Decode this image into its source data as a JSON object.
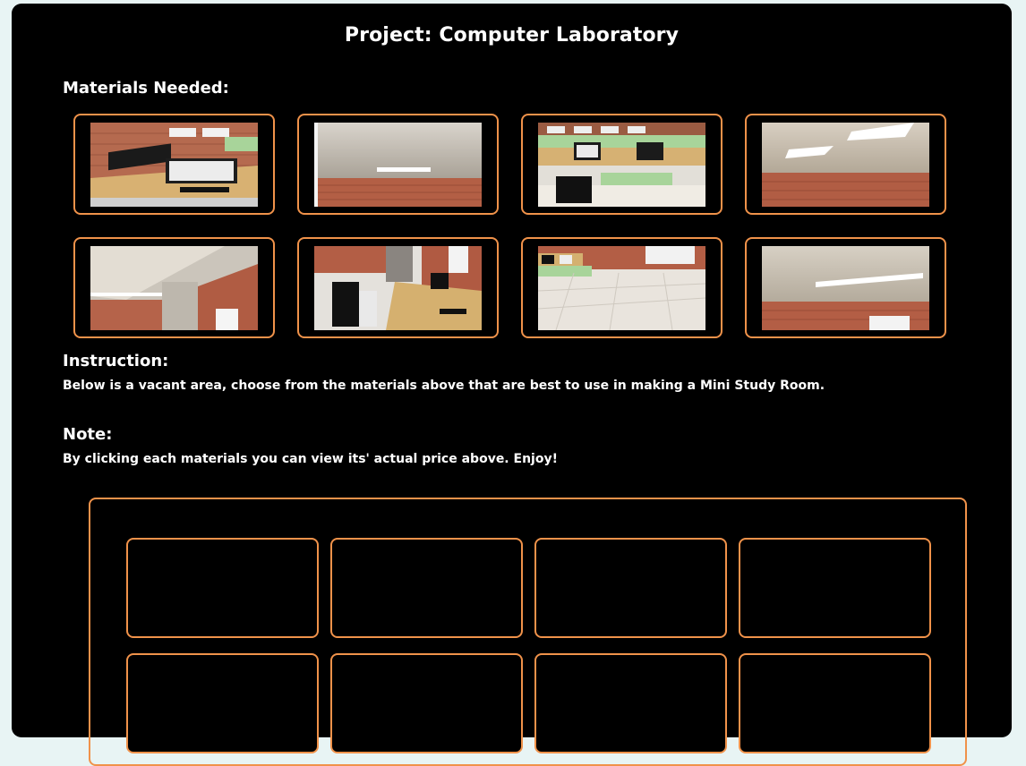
{
  "page": {
    "title": "Project: Computer Laboratory",
    "materials_heading": "Materials Needed:",
    "instruction_heading": "Instruction:",
    "instruction_text": "Below is a vacant area, choose from the materials above that are best to use in making a Mini Study Room.",
    "note_heading": "Note:",
    "note_text": "By clicking each materials you can view its' actual price above. Enjoy!"
  },
  "colors": {
    "accent": "#f0924a",
    "background": "#000000",
    "page_background": "#e8f4f4"
  },
  "materials": [
    {
      "icon": "computer-desks-image"
    },
    {
      "icon": "ceiling-light-image"
    },
    {
      "icon": "computer-room-image"
    },
    {
      "icon": "ceiling-lights-image"
    },
    {
      "icon": "ceiling-wall-image"
    },
    {
      "icon": "desk-chairs-image"
    },
    {
      "icon": "tile-floor-image"
    },
    {
      "icon": "ceiling-panel-image"
    }
  ],
  "slots_visible": 8
}
